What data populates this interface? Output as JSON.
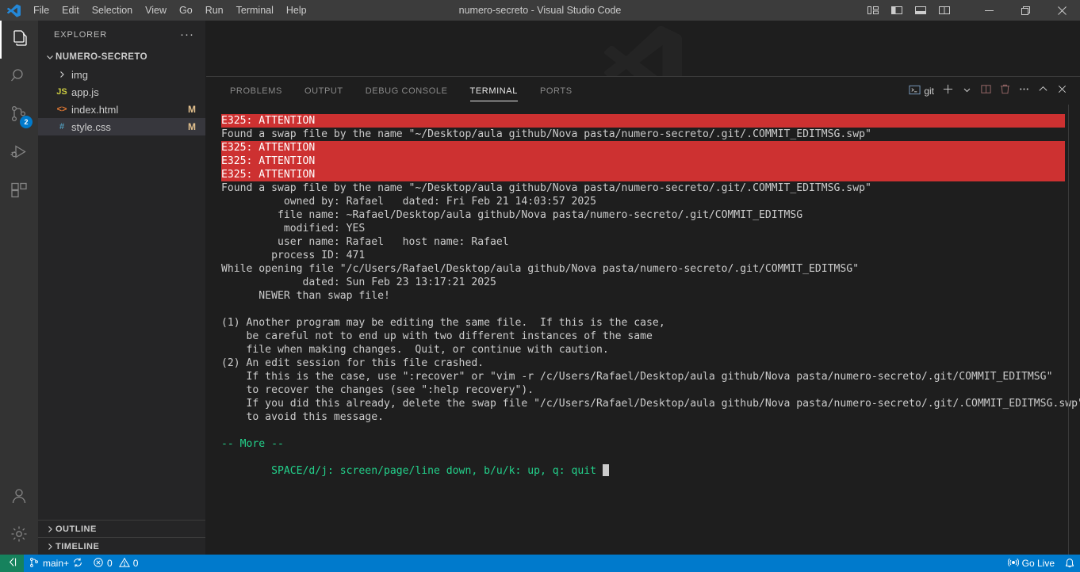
{
  "window": {
    "title": "numero-secreto - Visual Studio Code",
    "menu": [
      "File",
      "Edit",
      "Selection",
      "View",
      "Go",
      "Run",
      "Terminal",
      "Help"
    ],
    "layout_icons": [
      "toggle-panel-layout-icon",
      "toggle-primary-sidebar-icon",
      "toggle-panel-icon",
      "toggle-secondary-sidebar-icon"
    ],
    "controls": [
      "minimize",
      "maximize",
      "close"
    ],
    "colors": {
      "titlebar": "#3c3c3c",
      "accent": "#007acc",
      "error": "#cd3131",
      "terminal_green": "#23d18b"
    }
  },
  "activitybar": {
    "items": [
      {
        "name": "explorer",
        "icon": "files-icon",
        "active": true,
        "badge": ""
      },
      {
        "name": "search",
        "icon": "search-icon",
        "active": false,
        "badge": ""
      },
      {
        "name": "source-control",
        "icon": "source-control-icon",
        "active": false,
        "badge": "2"
      },
      {
        "name": "run-and-debug",
        "icon": "run-debug-icon",
        "active": false,
        "badge": ""
      },
      {
        "name": "extensions",
        "icon": "extensions-icon",
        "active": false,
        "badge": ""
      }
    ],
    "bottom": [
      {
        "name": "accounts",
        "icon": "account-icon"
      },
      {
        "name": "manage",
        "icon": "gear-icon"
      }
    ]
  },
  "sidebar": {
    "title": "EXPLORER",
    "more_actions": "···",
    "root_folder": "NUMERO-SECRETO",
    "files": [
      {
        "name": "img",
        "type": "folder",
        "icon": "chevron-right-icon",
        "icon_text": "",
        "icon_color": "#cccccc",
        "status": "",
        "selected": false
      },
      {
        "name": "app.js",
        "type": "file",
        "icon": "js-icon",
        "icon_text": "JS",
        "icon_color": "#cbcb41",
        "status": "",
        "selected": false
      },
      {
        "name": "index.html",
        "type": "file",
        "icon": "html-icon",
        "icon_text": "<>",
        "icon_color": "#e37933",
        "status": "M",
        "selected": false
      },
      {
        "name": "style.css",
        "type": "file",
        "icon": "css-icon",
        "icon_text": "#",
        "icon_color": "#519aba",
        "status": "M",
        "selected": true
      }
    ],
    "sections": [
      "OUTLINE",
      "TIMELINE"
    ]
  },
  "panel": {
    "tabs": [
      {
        "label": "PROBLEMS",
        "active": false
      },
      {
        "label": "OUTPUT",
        "active": false
      },
      {
        "label": "DEBUG CONSOLE",
        "active": false
      },
      {
        "label": "TERMINAL",
        "active": true
      },
      {
        "label": "PORTS",
        "active": false
      }
    ],
    "actions": [
      {
        "name": "terminal-profile-git",
        "icon": "terminal-icon",
        "label": "git"
      },
      {
        "name": "new-terminal",
        "icon": "plus-icon",
        "label": ""
      },
      {
        "name": "terminal-profile-dropdown",
        "icon": "chevron-down-icon",
        "label": ""
      },
      {
        "name": "split-terminal",
        "icon": "split-icon",
        "label": ""
      },
      {
        "name": "kill-terminal",
        "icon": "trash-icon",
        "label": ""
      },
      {
        "name": "panel-more-actions",
        "icon": "ellipsis-icon",
        "label": ""
      },
      {
        "name": "maximize-panel",
        "icon": "chevron-up-icon",
        "label": ""
      },
      {
        "name": "close-panel",
        "icon": "close-icon",
        "label": ""
      }
    ]
  },
  "terminal": {
    "lines": [
      {
        "text": "E325: ATTENTION",
        "style": "error"
      },
      {
        "text": "Found a swap file by the name \"~/Desktop/aula github/Nova pasta/numero-secreto/.git/.COMMIT_EDITMSG.swp\"",
        "style": "normal"
      },
      {
        "text": "E325: ATTENTION",
        "style": "error"
      },
      {
        "text": "E325: ATTENTION",
        "style": "error"
      },
      {
        "text": "E325: ATTENTION",
        "style": "error"
      },
      {
        "text": "Found a swap file by the name \"~/Desktop/aula github/Nova pasta/numero-secreto/.git/.COMMIT_EDITMSG.swp\"",
        "style": "normal"
      },
      {
        "text": "          owned by: Rafael   dated: Fri Feb 21 14:03:57 2025",
        "style": "normal"
      },
      {
        "text": "         file name: ~Rafael/Desktop/aula github/Nova pasta/numero-secreto/.git/COMMIT_EDITMSG",
        "style": "normal"
      },
      {
        "text": "          modified: YES",
        "style": "normal"
      },
      {
        "text": "         user name: Rafael   host name: Rafael",
        "style": "normal"
      },
      {
        "text": "        process ID: 471",
        "style": "normal"
      },
      {
        "text": "While opening file \"/c/Users/Rafael/Desktop/aula github/Nova pasta/numero-secreto/.git/COMMIT_EDITMSG\"",
        "style": "normal"
      },
      {
        "text": "             dated: Sun Feb 23 13:17:21 2025",
        "style": "normal"
      },
      {
        "text": "      NEWER than swap file!",
        "style": "normal"
      },
      {
        "text": "",
        "style": "normal"
      },
      {
        "text": "(1) Another program may be editing the same file.  If this is the case,",
        "style": "normal"
      },
      {
        "text": "    be careful not to end up with two different instances of the same",
        "style": "normal"
      },
      {
        "text": "    file when making changes.  Quit, or continue with caution.",
        "style": "normal"
      },
      {
        "text": "(2) An edit session for this file crashed.",
        "style": "normal"
      },
      {
        "text": "    If this is the case, use \":recover\" or \"vim -r /c/Users/Rafael/Desktop/aula github/Nova pasta/numero-secreto/.git/COMMIT_EDITMSG\"",
        "style": "normal"
      },
      {
        "text": "    to recover the changes (see \":help recovery\").",
        "style": "normal"
      },
      {
        "text": "    If you did this already, delete the swap file \"/c/Users/Rafael/Desktop/aula github/Nova pasta/numero-secreto/.git/.COMMIT_EDITMSG.swp\"",
        "style": "normal"
      },
      {
        "text": "    to avoid this message.",
        "style": "normal"
      },
      {
        "text": "",
        "style": "normal"
      },
      {
        "text": "-- More --",
        "style": "green"
      },
      {
        "text": "",
        "style": "normal"
      },
      {
        "text": "        SPACE/d/j: screen/page/line down, b/u/k: up, q: quit ",
        "style": "green-cursor"
      }
    ]
  },
  "statusbar": {
    "remote_icon": "remote-window-icon",
    "branch": "main+",
    "sync_icon": "sync-icon",
    "errors": "0",
    "warnings": "0",
    "go_live": "Go Live",
    "bell_icon": "bell-icon"
  }
}
